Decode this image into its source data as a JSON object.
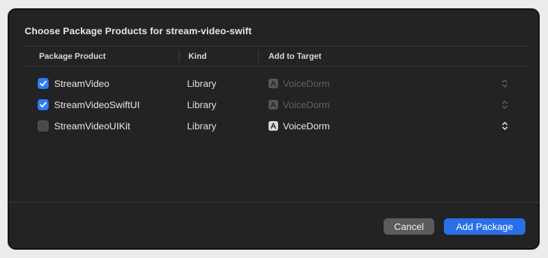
{
  "dialog": {
    "title": "Choose Package Products for stream-video-swift"
  },
  "table": {
    "columns": [
      "Package Product",
      "Kind",
      "Add to Target"
    ],
    "rows": [
      {
        "product": "StreamVideo",
        "checked": true,
        "kind": "Library",
        "target": "VoiceDorm",
        "target_enabled": false
      },
      {
        "product": "StreamVideoSwiftUI",
        "checked": true,
        "kind": "Library",
        "target": "VoiceDorm",
        "target_enabled": false
      },
      {
        "product": "StreamVideoUIKit",
        "checked": false,
        "kind": "Library",
        "target": "VoiceDorm",
        "target_enabled": true
      }
    ]
  },
  "buttons": {
    "cancel": "Cancel",
    "add": "Add Package"
  },
  "icons": {
    "checkbox_checked": "checkmark-icon",
    "target": "app-target-icon",
    "popup": "chevron-up-down-icon"
  },
  "colors": {
    "accent": "#2b6fe6",
    "dialog_bg": "#232325"
  }
}
